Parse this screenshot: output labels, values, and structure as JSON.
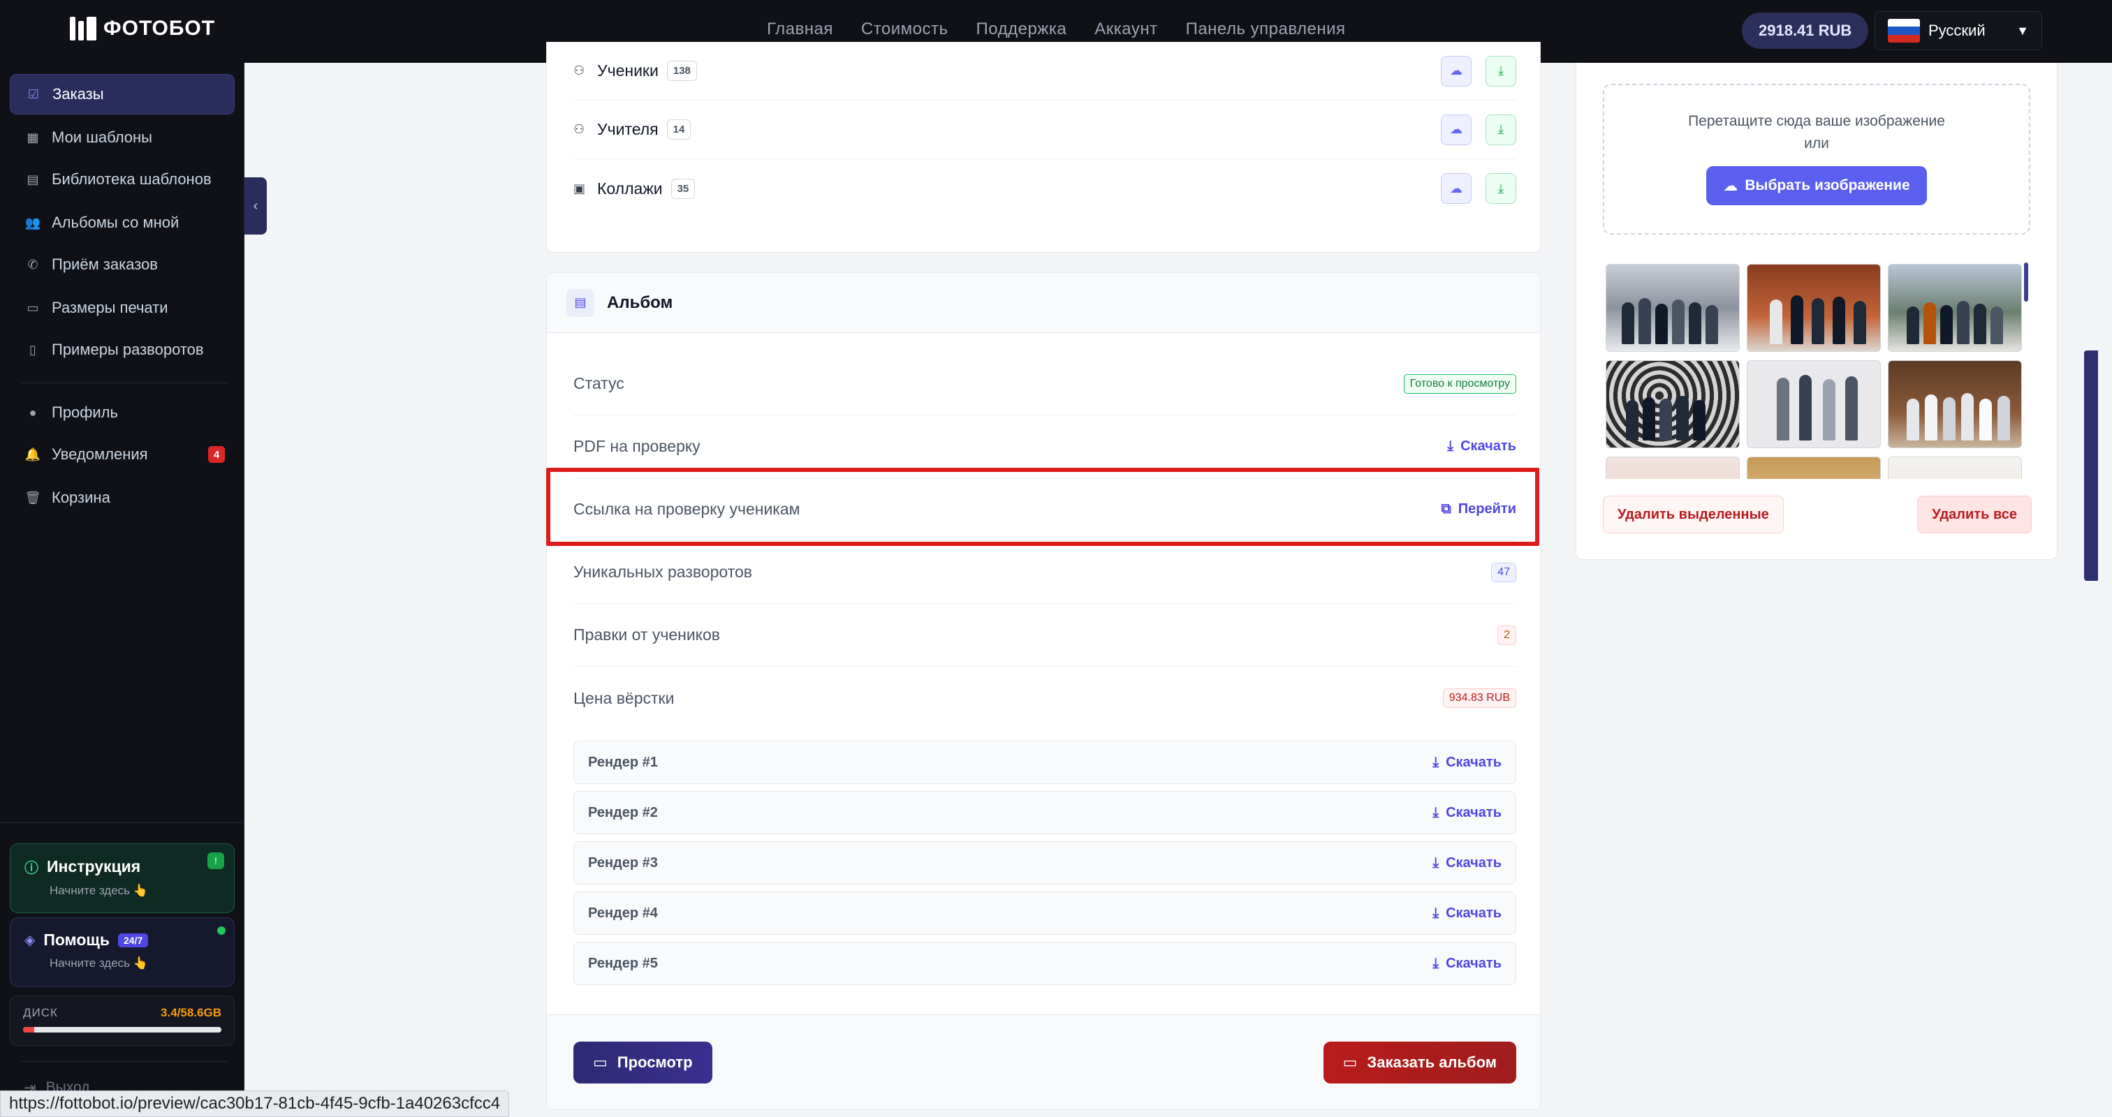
{
  "brand": {
    "name": "ФОТОБОТ"
  },
  "topnav": [
    "Главная",
    "Стоимость",
    "Поддержка",
    "Аккаунт",
    "Панель управления"
  ],
  "balance": "2918.41 RUB",
  "language": {
    "selected": "Русский"
  },
  "sidebar": {
    "items": [
      {
        "label": "Заказы",
        "icon": "checkbox-icon",
        "active": true
      },
      {
        "label": "Мои шаблоны",
        "icon": "grid-icon"
      },
      {
        "label": "Библиотека шаблонов",
        "icon": "library-icon"
      },
      {
        "label": "Альбомы со мной",
        "icon": "users-icon"
      },
      {
        "label": "Приём заказов",
        "icon": "phone-icon"
      },
      {
        "label": "Размеры печати",
        "icon": "monitor-icon"
      },
      {
        "label": "Примеры разворотов",
        "icon": "document-icon"
      }
    ],
    "account_items": [
      {
        "label": "Профиль",
        "icon": "user-icon"
      },
      {
        "label": "Уведомления",
        "icon": "bell-icon",
        "badge": "4"
      },
      {
        "label": "Корзина",
        "icon": "trash-icon"
      }
    ],
    "instruction": {
      "title": "Инструкция",
      "subtitle": "Начните здесь 👆",
      "badge": "!"
    },
    "help": {
      "title": "Помощь",
      "badge": "24/7",
      "subtitle": "Начните здесь 👆"
    },
    "disk": {
      "label": "ДИСК",
      "value": "3.4/58.6GB",
      "fill_fraction": 0.058
    },
    "logout": "Выход"
  },
  "categories": [
    {
      "label": "Ученики",
      "count": "138",
      "icon": "user-icon"
    },
    {
      "label": "Учителя",
      "count": "14",
      "icon": "users-icon"
    },
    {
      "label": "Коллажи",
      "count": "35",
      "icon": "image-icon"
    }
  ],
  "album": {
    "title": "Альбом",
    "status_label": "Статус",
    "status_value": "Готово к просмотру",
    "pdf_label": "PDF на проверку",
    "pdf_action": "Скачать",
    "link_label": "Ссылка на проверку ученикам",
    "link_action": "Перейти",
    "spreads_label": "Уникальных разворотов",
    "spreads_value": "47",
    "edits_label": "Правки от учеников",
    "edits_value": "2",
    "price_label": "Цена вёрстки",
    "price_value": "934.83 RUB",
    "renders": [
      {
        "label": "Рендер #1",
        "action": "Скачать"
      },
      {
        "label": "Рендер #2",
        "action": "Скачать"
      },
      {
        "label": "Рендер #3",
        "action": "Скачать"
      },
      {
        "label": "Рендер #4",
        "action": "Скачать"
      },
      {
        "label": "Рендер #5",
        "action": "Скачать"
      }
    ],
    "preview_button": "Просмотр",
    "order_button": "Заказать альбом"
  },
  "upload": {
    "dropzone_text": "Перетащите сюда ваше изображение",
    "dropzone_or": "или",
    "choose_button": "Выбрать изображение",
    "delete_selected": "Удалить выделенные",
    "delete_all": "Удалить все"
  },
  "status_url": "https://fottobot.io/preview/cac30b17-81cb-4f45-9cfb-1a40263cfcc4",
  "colors": {
    "accent": "#5b5fef",
    "danger": "#b91c1c",
    "sidebar_bg": "#0f1117"
  }
}
